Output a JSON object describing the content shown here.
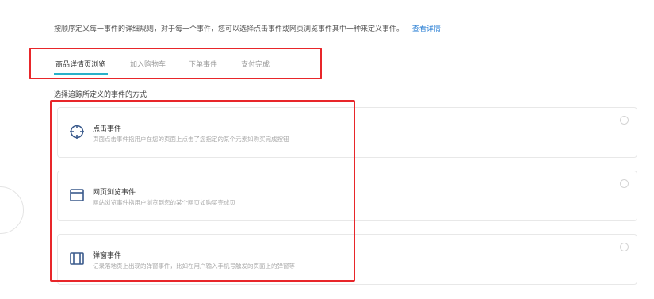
{
  "intro": {
    "text": "按顺序定义每一事件的详细规则，对于每一个事件，您可以选择点击事件或网页浏览事件其中一种来定义事件。",
    "link": "查看详情"
  },
  "tabs": [
    {
      "label": "商品详情页浏览",
      "active": true
    },
    {
      "label": "加入购物车",
      "active": false
    },
    {
      "label": "下单事件",
      "active": false
    },
    {
      "label": "支付完成",
      "active": false
    }
  ],
  "section_title": "选择追踪所定义的事件的方式",
  "options": [
    {
      "title": "点击事件",
      "desc": "页面点击事件指用户在您的页面上点击了您指定的某个元素如购买完成按钮",
      "icon": "crosshair-icon"
    },
    {
      "title": "网页浏览事件",
      "desc": "网站浏览事件指用户浏览到您的某个网页如购买完成页",
      "icon": "browser-window-icon"
    },
    {
      "title": "弹窗事件",
      "desc": "记录落地页上出现的弹窗事件，比如在用户输入手机号触发的页面上的弹窗等",
      "icon": "popup-window-icon"
    }
  ],
  "colors": {
    "accent": "#2ab0c9",
    "highlight": "#e8262a",
    "link": "#2a7fd4"
  }
}
